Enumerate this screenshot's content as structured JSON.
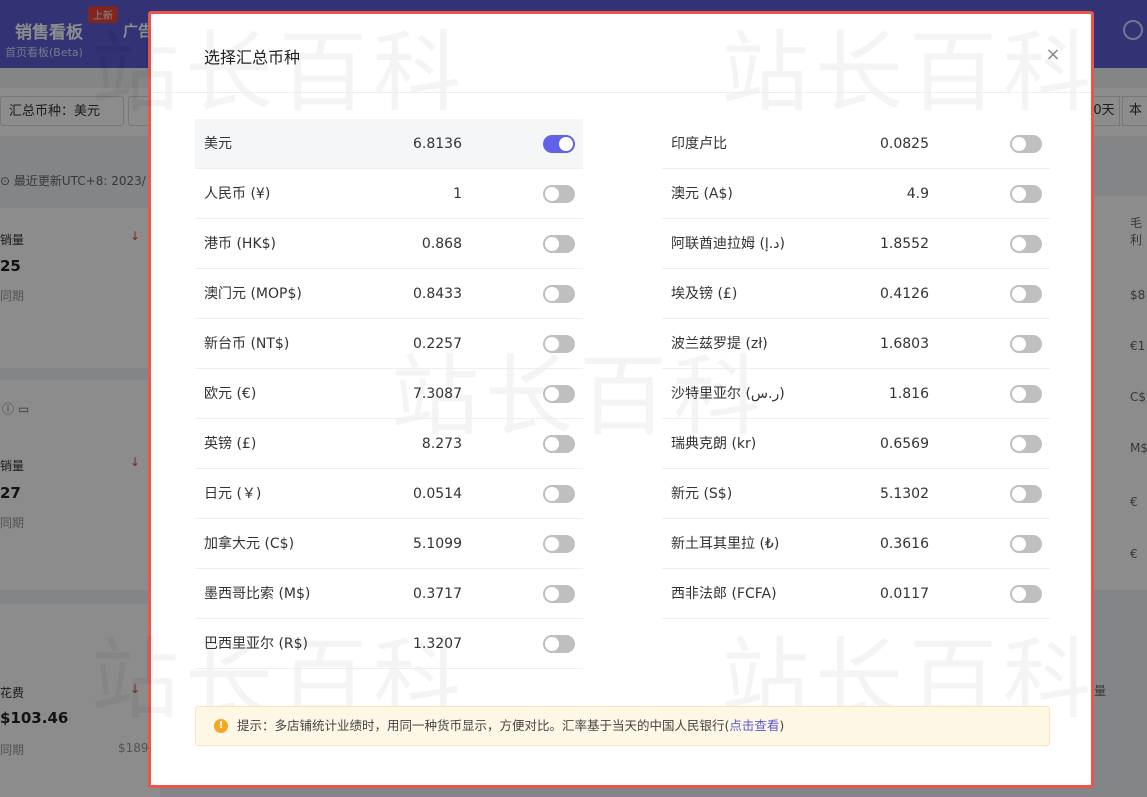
{
  "app": {
    "brand": "销售看板",
    "brand_sub": "首页看板(Beta)",
    "badge_new": "上新",
    "nav2": "广告",
    "currency_select": "汇总币种：美元",
    "day_btn": "0天",
    "cur_btn": "本",
    "update_text": "最近更新UTC+8: 2023/",
    "cards": [
      {
        "label": "销量",
        "big": "25",
        "small": "同期"
      },
      {
        "label": "销量",
        "big": "27",
        "small": "同期"
      },
      {
        "label": "花费",
        "big": "$103.46",
        "small": "同期",
        "extra": "$189"
      }
    ],
    "right_col_header": "毛利",
    "right_col_values": [
      "$8",
      "€1",
      "C$",
      "M$",
      "€",
      "€"
    ],
    "right_bottom": "量",
    "arrow": "↓"
  },
  "modal": {
    "title": "选择汇总币种",
    "close_label": "×",
    "left": [
      {
        "name": "美元",
        "rate": "6.8136",
        "on": true
      },
      {
        "name": "人民币 (¥)",
        "rate": "1",
        "on": false
      },
      {
        "name": "港币 (HK$)",
        "rate": "0.868",
        "on": false
      },
      {
        "name": "澳门元 (MOP$)",
        "rate": "0.8433",
        "on": false
      },
      {
        "name": "新台币 (NT$)",
        "rate": "0.2257",
        "on": false
      },
      {
        "name": "欧元 (€)",
        "rate": "7.3087",
        "on": false
      },
      {
        "name": "英镑 (£)",
        "rate": "8.273",
        "on": false
      },
      {
        "name": "日元 (￥)",
        "rate": "0.0514",
        "on": false
      },
      {
        "name": "加拿大元 (C$)",
        "rate": "5.1099",
        "on": false
      },
      {
        "name": "墨西哥比索 (M$)",
        "rate": "0.3717",
        "on": false
      },
      {
        "name": "巴西里亚尔 (R$)",
        "rate": "1.3207",
        "on": false
      }
    ],
    "right": [
      {
        "name": "印度卢比",
        "rate": "0.0825",
        "on": false
      },
      {
        "name": "澳元 (A$)",
        "rate": "4.9",
        "on": false
      },
      {
        "name": "阿联酋迪拉姆 (د.إ)",
        "rate": "1.8552",
        "on": false
      },
      {
        "name": "埃及镑 (£)",
        "rate": "0.4126",
        "on": false
      },
      {
        "name": "波兰兹罗提 (zł)",
        "rate": "1.6803",
        "on": false
      },
      {
        "name": "沙特里亚尔 (ر.س)",
        "rate": "1.816",
        "on": false
      },
      {
        "name": "瑞典克朗 (kr)",
        "rate": "0.6569",
        "on": false
      },
      {
        "name": "新元 (S$)",
        "rate": "5.1302",
        "on": false
      },
      {
        "name": "新土耳其里拉 (₺)",
        "rate": "0.3616",
        "on": false
      },
      {
        "name": "西非法郎 (FCFA)",
        "rate": "0.0117",
        "on": false
      }
    ],
    "notice_prefix": "提示：多店铺统计业绩时，用同一种货币显示，方便对比。汇率基于当天的中国人民银行(",
    "notice_link": "点击查看",
    "notice_suffix": ")",
    "notice_icon": "!"
  },
  "watermark": "站长百科",
  "colors": {
    "accent": "#6262e8",
    "topbar": "#5b5bd6",
    "modal_border": "#e8564c",
    "toggle_off": "#bfbfbf",
    "notice_bg": "#fff7e6"
  }
}
